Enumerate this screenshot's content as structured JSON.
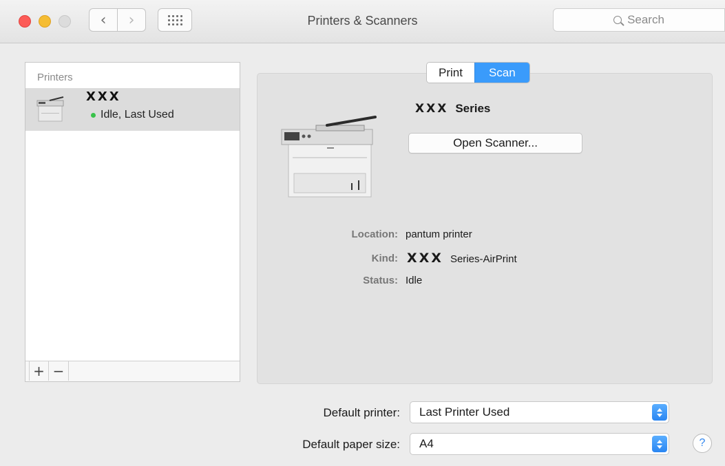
{
  "window": {
    "title": "Printers & Scanners"
  },
  "toolbar": {
    "back_glyph": "‹",
    "forward_glyph": "›",
    "search_placeholder": "Search"
  },
  "printers": {
    "header": "Printers",
    "items": [
      {
        "name": "XXX",
        "status": "Idle, Last Used"
      }
    ],
    "add_label": "+",
    "remove_label": "−"
  },
  "tabs": {
    "items": [
      "Print",
      "Scan"
    ],
    "selected": "Scan"
  },
  "device": {
    "name_prefix": "XXX",
    "name_suffix": "Series",
    "open_scanner_label": "Open Scanner...",
    "location_label": "Location:",
    "location_value": "pantum printer",
    "kind_label": "Kind:",
    "kind_prefix": "XXX",
    "kind_suffix": "Series-AirPrint",
    "status_label": "Status:",
    "status_value": "Idle"
  },
  "defaults": {
    "printer_label": "Default printer:",
    "printer_value": "Last Printer Used",
    "paper_label": "Default paper size:",
    "paper_value": "A4"
  },
  "help": {
    "label": "?"
  },
  "colors": {
    "accent": "#3a9bfb",
    "status_idle": "#39c24a"
  }
}
